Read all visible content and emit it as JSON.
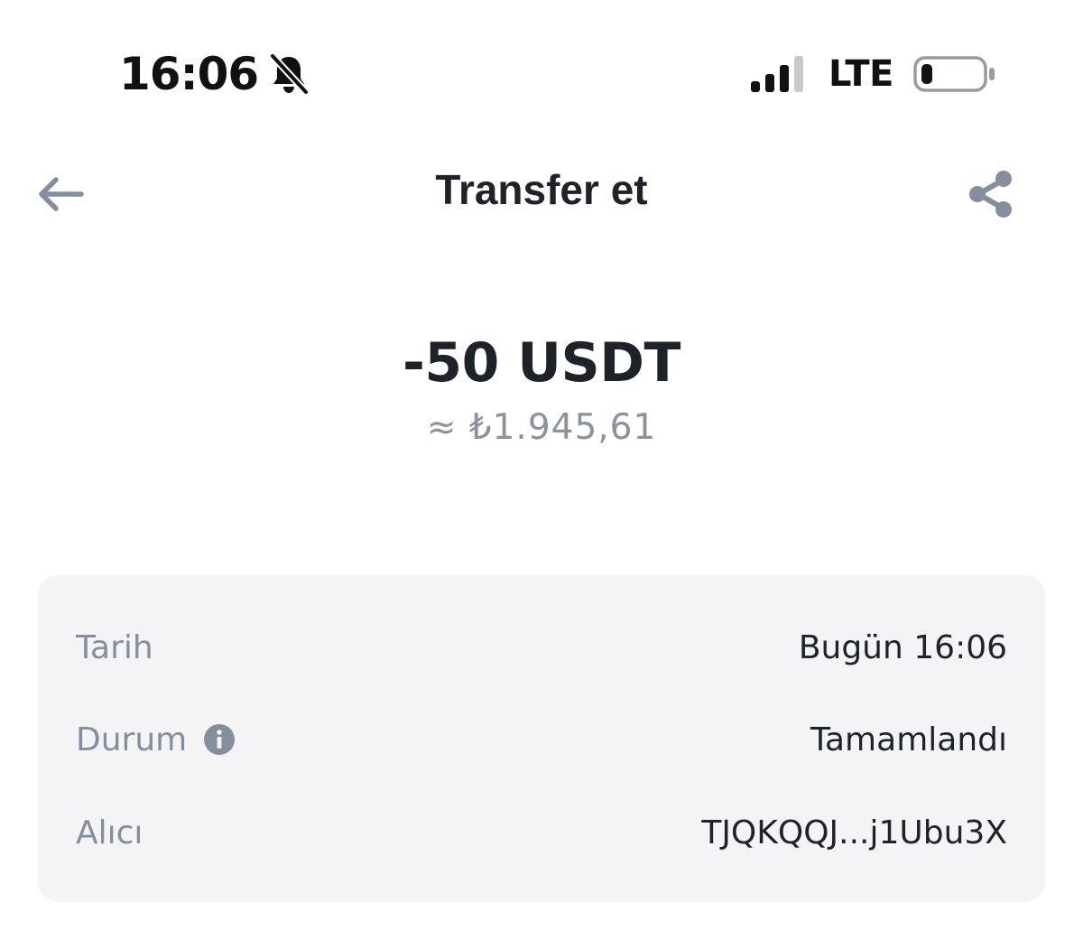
{
  "status_bar": {
    "time": "16:06",
    "network": "LTE",
    "icons": [
      "bell-off-icon",
      "signal-icon",
      "battery-icon"
    ]
  },
  "header": {
    "title": "Transfer et",
    "icons": [
      "arrow-left-icon",
      "share-icon"
    ]
  },
  "amount": {
    "value": "-50 USDT",
    "fiat": "≈ ₺1.945,61"
  },
  "details": {
    "rows": [
      {
        "label": "Tarih",
        "value": "Bugün 16:06"
      },
      {
        "label": "Durum",
        "value": "Tamamlandı",
        "icon": "info-icon"
      },
      {
        "label": "Alıcı",
        "value": "TJQKQQJ...j1Ubu3X"
      }
    ]
  },
  "colors": {
    "text_primary": "#1e2329",
    "text_secondary": "#848e9c",
    "card_background": "#f4f4f6",
    "icon_gray": "#848e9c"
  }
}
